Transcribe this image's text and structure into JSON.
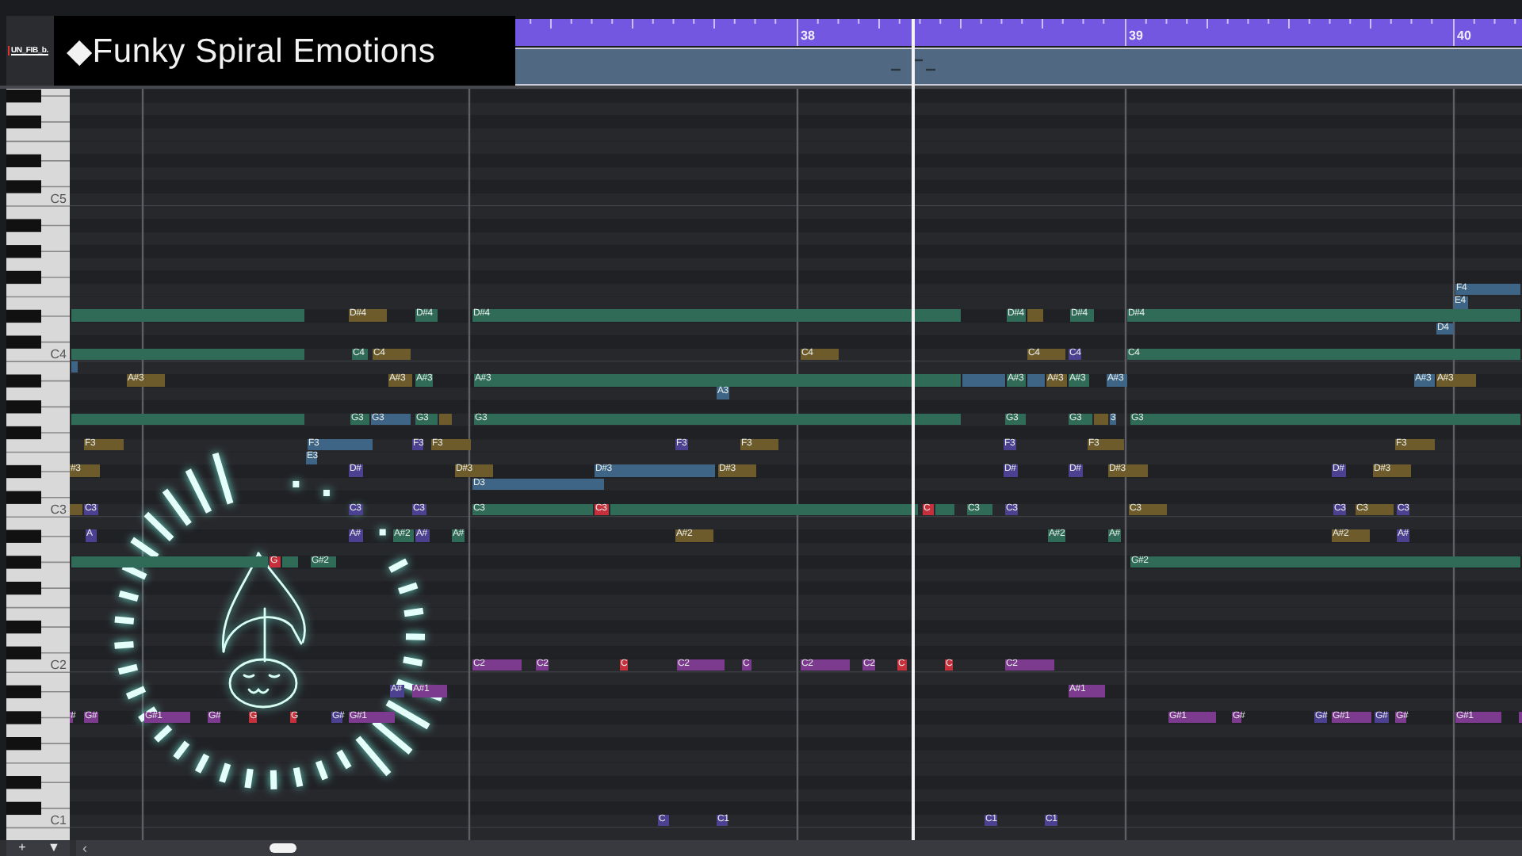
{
  "header": {
    "track_name": "UN_FIB_b.",
    "title": "◆Funky Spiral Emotions"
  },
  "ruler": {
    "marks": [
      {
        "label": "38"
      },
      {
        "label": "39"
      },
      {
        "label": "40"
      }
    ]
  },
  "keyboard": {
    "labels": [
      "C5",
      "C4",
      "C3",
      "C2",
      "C1"
    ]
  },
  "lanes": [
    {
      "notes": [
        {
          "label": "F4",
          "color": "#3e6586"
        }
      ]
    },
    {
      "notes": [
        {
          "label": "E4",
          "color": "#3e6586"
        }
      ]
    },
    {
      "notes": [
        {
          "color": "#2f6b56"
        },
        {
          "label": "D#4",
          "color": "#6e5b2b"
        },
        {
          "label": "D#4",
          "color": "#2f6b56"
        },
        {
          "label": "D#4",
          "color": "#2f6b56"
        },
        {
          "label": "D#4",
          "color": "#2f6b56"
        },
        {
          "color": "#6e5b2b"
        },
        {
          "label": "D#4",
          "color": "#2f6b56"
        },
        {
          "label": "D#4",
          "color": "#2f6b56"
        }
      ]
    },
    {
      "notes": [
        {
          "label": "D4",
          "color": "#3e6586"
        }
      ]
    },
    {
      "notes": [
        {
          "color": "#2f6b56"
        },
        {
          "label": "C4",
          "color": "#2f6b56"
        },
        {
          "label": "C4",
          "color": "#6e5b2b"
        },
        {
          "label": "C4",
          "color": "#6e5b2b"
        },
        {
          "label": "C4",
          "color": "#6e5b2b"
        },
        {
          "label": "C4",
          "color": "#4c4190"
        },
        {
          "label": "C4",
          "color": "#2f6b56"
        }
      ]
    },
    {
      "notes": [
        {
          "color": "#3e6586"
        }
      ]
    },
    {
      "notes": [
        {
          "label": "A#3",
          "color": "#6e5b2b"
        },
        {
          "label": "A#3",
          "color": "#6e5b2b"
        },
        {
          "label": "A#3",
          "color": "#2f6b56"
        },
        {
          "label": "A#3",
          "color": "#2f6b56"
        },
        {
          "color": "#3e6586"
        },
        {
          "label": "A#3",
          "color": "#2f6b56"
        },
        {
          "color": "#3e6586"
        },
        {
          "label": "A#3",
          "color": "#6e5b2b"
        },
        {
          "label": "A#3",
          "color": "#2f6b56"
        },
        {
          "label": "A#3",
          "color": "#3e6586"
        },
        {
          "label": "A#3",
          "color": "#3e6586"
        },
        {
          "label": "A#3",
          "color": "#6e5b2b"
        }
      ]
    },
    {
      "notes": [
        {
          "label": "A3",
          "color": "#3e6586"
        }
      ]
    },
    {
      "notes": [
        {
          "color": "#2f6b56"
        },
        {
          "label": "G3",
          "color": "#2f6b56"
        },
        {
          "label": "G3",
          "color": "#3e6586"
        },
        {
          "label": "G3",
          "color": "#2f6b56"
        },
        {
          "color": "#6e5b2b"
        },
        {
          "label": "G3",
          "color": "#2f6b56"
        },
        {
          "label": "G3",
          "color": "#2f6b56"
        },
        {
          "label": "G3",
          "color": "#2f6b56"
        },
        {
          "color": "#6e5b2b"
        },
        {
          "label": "3",
          "color": "#3e6586"
        },
        {
          "label": "G3",
          "color": "#2f6b56"
        }
      ]
    },
    {
      "notes": [
        {
          "label": "F3",
          "color": "#6e5b2b"
        },
        {
          "label": "F3",
          "color": "#3e6586"
        },
        {
          "label": "F3",
          "color": "#4c4190"
        },
        {
          "label": "F3",
          "color": "#6e5b2b"
        },
        {
          "label": "F3",
          "color": "#4c4190"
        },
        {
          "label": "F3",
          "color": "#6e5b2b"
        },
        {
          "label": "F3",
          "color": "#4c4190"
        },
        {
          "label": "F3",
          "color": "#6e5b2b"
        },
        {
          "label": "F3",
          "color": "#6e5b2b"
        }
      ]
    },
    {
      "notes": [
        {
          "label": "E3",
          "color": "#3e6586"
        }
      ]
    },
    {
      "notes": [
        {
          "label": "#3",
          "color": "#6e5b2b"
        },
        {
          "label": "D#",
          "color": "#4c4190"
        },
        {
          "label": "D#3",
          "color": "#6e5b2b"
        },
        {
          "label": "D#3",
          "color": "#3e6586"
        },
        {
          "label": "D#3",
          "color": "#6e5b2b"
        },
        {
          "label": "D#",
          "color": "#4c4190"
        },
        {
          "label": "D#",
          "color": "#4c4190"
        },
        {
          "label": "D#3",
          "color": "#6e5b2b"
        },
        {
          "label": "D#",
          "color": "#4c4190"
        },
        {
          "label": "D#3",
          "color": "#6e5b2b"
        }
      ]
    },
    {
      "notes": [
        {
          "label": "D3",
          "color": "#3e6586"
        }
      ]
    },
    {
      "notes": [
        {
          "color": "#6e5b2b"
        },
        {
          "label": "C3",
          "color": "#4c4190"
        },
        {
          "label": "C3",
          "color": "#4c4190"
        },
        {
          "label": "C3",
          "color": "#4c4190"
        },
        {
          "label": "C3",
          "color": "#2f6b56"
        },
        {
          "label": "C3",
          "color": "#c6303c"
        },
        {
          "color": "#2f6b56"
        },
        {
          "label": "C",
          "color": "#c6303c"
        },
        {
          "color": "#2f6b56"
        },
        {
          "label": "C3",
          "color": "#2f6b56"
        },
        {
          "label": "C3",
          "color": "#4c4190"
        },
        {
          "label": "C3",
          "color": "#6e5b2b"
        },
        {
          "label": "C3",
          "color": "#4c4190"
        },
        {
          "label": "C3",
          "color": "#6e5b2b"
        },
        {
          "label": "C3",
          "color": "#4c4190"
        }
      ]
    },
    {
      "notes": [
        {
          "label": "A",
          "color": "#4c4190"
        },
        {
          "label": "A#",
          "color": "#4c4190"
        },
        {
          "label": "A#2",
          "color": "#2f6b56"
        },
        {
          "label": "A#",
          "color": "#4c4190"
        },
        {
          "label": "A#",
          "color": "#2f6b56"
        },
        {
          "label": "A#2",
          "color": "#6e5b2b"
        },
        {
          "label": "A#2",
          "color": "#2f6b56"
        },
        {
          "label": "A#",
          "color": "#2f6b56"
        },
        {
          "label": "A#2",
          "color": "#6e5b2b"
        },
        {
          "label": "A#",
          "color": "#4c4190"
        }
      ]
    },
    {
      "notes": [
        {
          "color": "#2f6b56"
        },
        {
          "label": "G",
          "color": "#c6303c"
        },
        {
          "color": "#2f6b56"
        },
        {
          "label": "G#2",
          "color": "#2f6b56"
        },
        {
          "label": "G#2",
          "color": "#2f6b56"
        }
      ]
    },
    {
      "notes": [
        {
          "label": "C2",
          "color": "#7c3b8e"
        },
        {
          "label": "C2",
          "color": "#7c3b8e"
        },
        {
          "label": "C",
          "color": "#c6303c"
        },
        {
          "label": "C2",
          "color": "#7c3b8e"
        },
        {
          "label": "C",
          "color": "#7c3b8e"
        },
        {
          "label": "C2",
          "color": "#7c3b8e"
        },
        {
          "label": "C2",
          "color": "#7c3b8e"
        },
        {
          "label": "C",
          "color": "#c6303c"
        },
        {
          "label": "C",
          "color": "#c6303c"
        },
        {
          "label": "C2",
          "color": "#7c3b8e"
        }
      ]
    },
    {
      "notes": [
        {
          "label": "A#",
          "color": "#4c4190"
        },
        {
          "label": "A#1",
          "color": "#7c3b8e"
        },
        {
          "label": "A#1",
          "color": "#7c3b8e"
        }
      ]
    },
    {
      "notes": [
        {
          "label": "#",
          "color": "#7c3b8e"
        },
        {
          "label": "G#",
          "color": "#7c3b8e"
        },
        {
          "label": "G#1",
          "color": "#7c3b8e"
        },
        {
          "label": "G#",
          "color": "#7c3b8e"
        },
        {
          "label": "G",
          "color": "#c6303c"
        },
        {
          "label": "G",
          "color": "#c6303c"
        },
        {
          "label": "G#",
          "color": "#4c4190"
        },
        {
          "label": "G#1",
          "color": "#7c3b8e"
        },
        {
          "label": "G#1",
          "color": "#7c3b8e"
        },
        {
          "label": "G#",
          "color": "#7c3b8e"
        },
        {
          "label": "G#",
          "color": "#4c4190"
        },
        {
          "label": "G#1",
          "color": "#7c3b8e"
        },
        {
          "label": "G#",
          "color": "#4c4190"
        },
        {
          "label": "G#",
          "color": "#7c3b8e"
        },
        {
          "label": "G#1",
          "color": "#7c3b8e"
        },
        {
          "color": "#7c3b8e"
        }
      ]
    },
    {
      "notes": [
        {
          "label": "C",
          "color": "#4c4190"
        },
        {
          "label": "C1",
          "color": "#4c4190"
        },
        {
          "label": "C1",
          "color": "#4c4190"
        },
        {
          "label": "C1",
          "color": "#4c4190"
        }
      ]
    }
  ],
  "footer": {
    "add_button": "+",
    "menu_button": "▼",
    "scroll_left": "‹"
  }
}
